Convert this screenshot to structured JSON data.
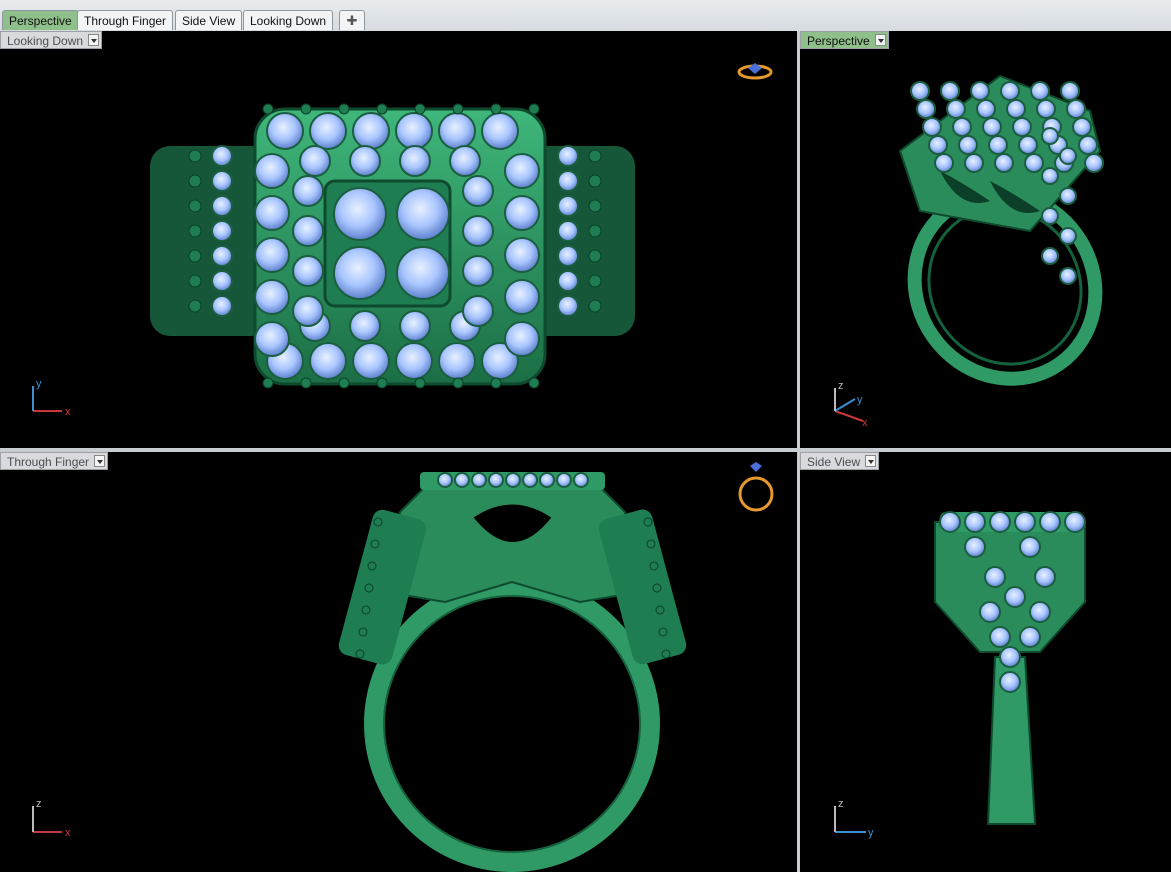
{
  "tabs": [
    {
      "label": "Perspective",
      "active": true
    },
    {
      "label": "Through Finger",
      "active": false
    },
    {
      "label": "Side View",
      "active": false
    },
    {
      "label": "Looking Down",
      "active": false
    }
  ],
  "add_tab_icon": "plus-icon",
  "viewports": {
    "top_left": {
      "label": "Looking Down",
      "axes": [
        "y",
        "x"
      ]
    },
    "top_right": {
      "label": "Perspective",
      "axes": [
        "z",
        "y",
        "x"
      ]
    },
    "bottom_left": {
      "label": "Through Finger",
      "axes": [
        "z",
        "x"
      ]
    },
    "bottom_right": {
      "label": "Side View",
      "axes": [
        "z",
        "y"
      ]
    }
  },
  "colors": {
    "metal": "#2f9a65",
    "metal_dark": "#14613d",
    "gem": "#a9c6ff",
    "gem_dark": "#6f8fd6",
    "active_tab": "#8fbf8a",
    "axis_x": "#c8383a",
    "axis_y": "#3f8fd0",
    "axis_z": "#b8b8b8"
  }
}
